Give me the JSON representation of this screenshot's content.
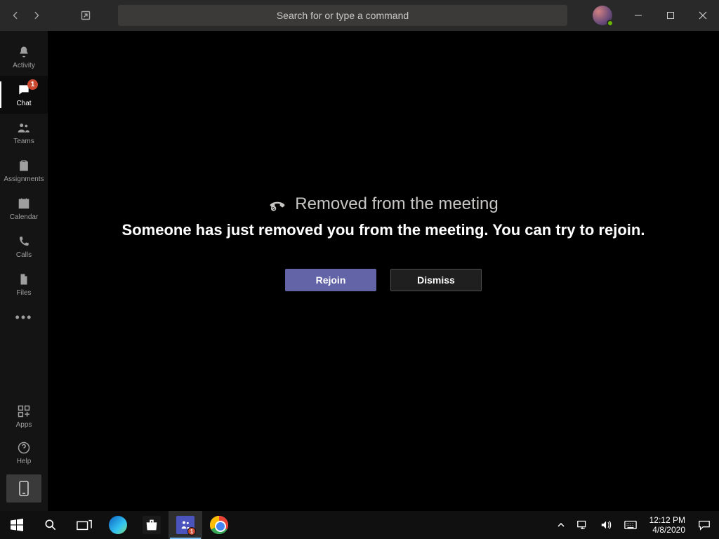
{
  "titlebar": {
    "search_placeholder": "Search for or type a command"
  },
  "rail": {
    "items": [
      {
        "label": "Activity"
      },
      {
        "label": "Chat",
        "badge": "1"
      },
      {
        "label": "Teams"
      },
      {
        "label": "Assignments"
      },
      {
        "label": "Calendar"
      },
      {
        "label": "Calls"
      },
      {
        "label": "Files"
      }
    ],
    "apps_label": "Apps",
    "help_label": "Help"
  },
  "dialog": {
    "title": "Removed from the meeting",
    "message": "Someone has just removed you from the meeting. You can try to rejoin.",
    "rejoin_label": "Rejoin",
    "dismiss_label": "Dismiss"
  },
  "taskbar": {
    "time": "12:12 PM",
    "date": "4/8/2020",
    "teams_badge": "1"
  }
}
